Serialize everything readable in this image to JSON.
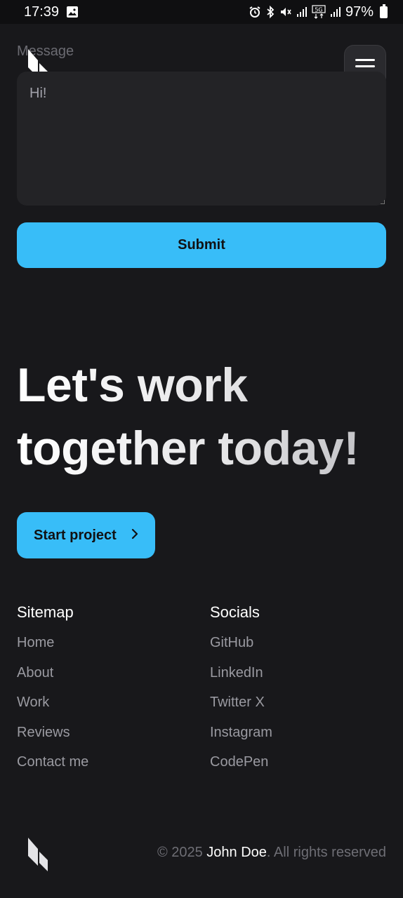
{
  "status_bar": {
    "time": "17:39",
    "battery": "97%",
    "icons": [
      "image-icon",
      "alarm-icon",
      "bluetooth-icon",
      "mute-icon",
      "signal-icon",
      "5g-icon",
      "signal-icon",
      "battery-icon"
    ]
  },
  "header": {
    "logo_icon": "brand-logo",
    "menu_icon": "hamburger-menu-icon"
  },
  "form": {
    "message_label": "Message",
    "message_value": "Hi!",
    "submit_label": "Submit"
  },
  "hero": {
    "line1": "Let's work",
    "line2": "together today!",
    "cta_label": "Start project",
    "cta_icon": "chevron-right-icon"
  },
  "footer": {
    "sitemap": {
      "title": "Sitemap",
      "items": [
        "Home",
        "About",
        "Work",
        "Reviews",
        "Contact me"
      ]
    },
    "socials": {
      "title": "Socials",
      "items": [
        "GitHub",
        "LinkedIn",
        "Twitter X",
        "Instagram",
        "CodePen"
      ]
    },
    "copyright_prefix": "© 2025 ",
    "copyright_owner": "John Doe",
    "copyright_suffix": ". All rights reserved"
  },
  "colors": {
    "background": "#18181b",
    "accent": "#38bdf8",
    "input_bg": "#232326"
  }
}
